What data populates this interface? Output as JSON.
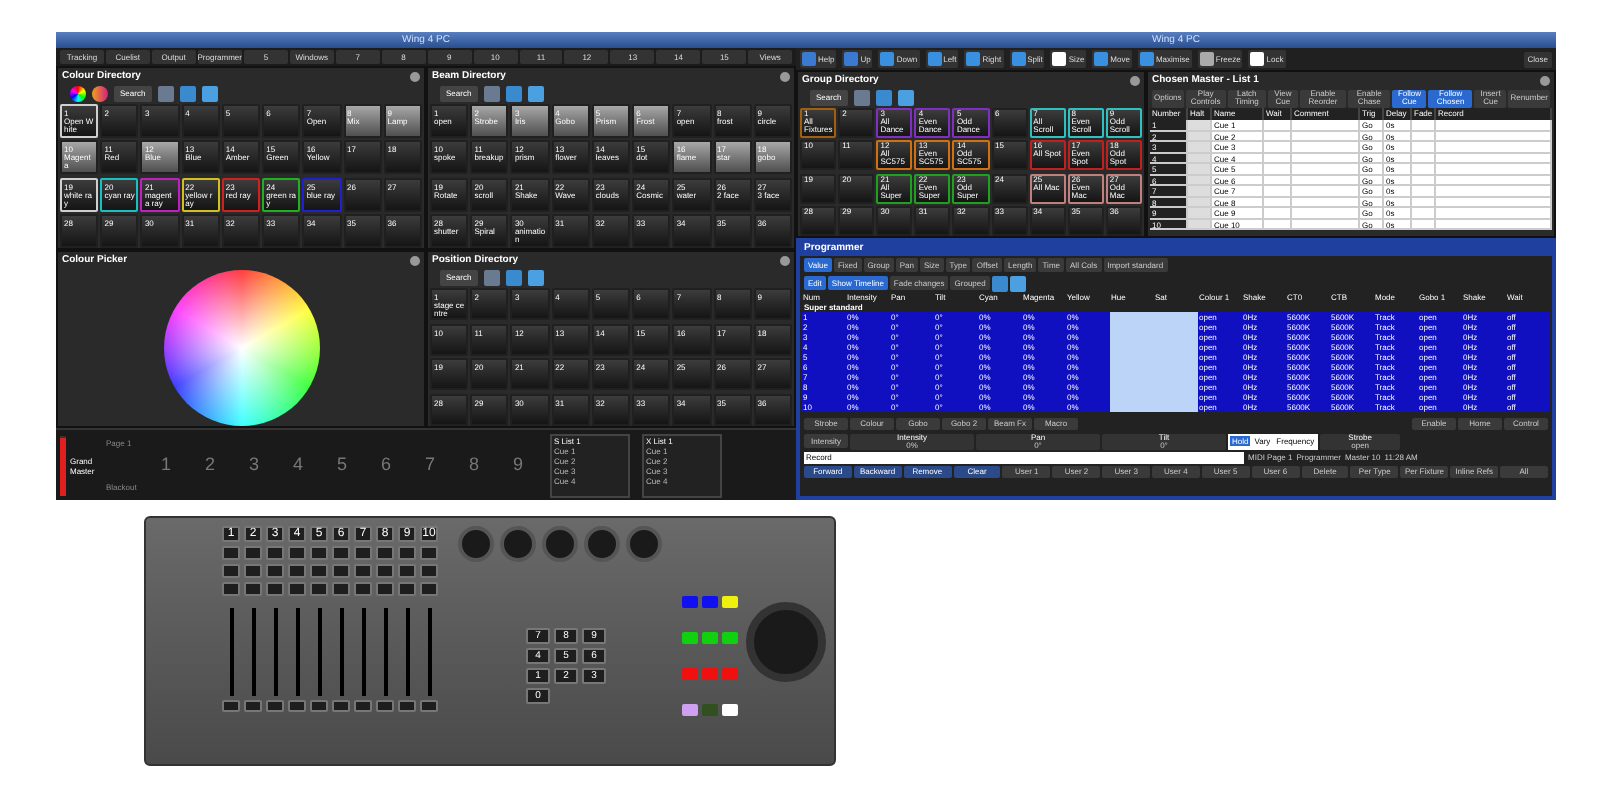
{
  "left_window": {
    "title": "Wing 4 PC",
    "tabs": [
      "Tracking",
      "Cuelist",
      "Output",
      "Programmer",
      "5",
      "Windows",
      "7",
      "8",
      "9",
      "10",
      "11",
      "12",
      "13",
      "14",
      "15",
      "Views"
    ],
    "colour_directory": {
      "title": "Colour Directory",
      "search": "Search",
      "cells": [
        {
          "number": "1",
          "label": "Open White",
          "kind": "outlined"
        },
        {
          "number": "2",
          "kind": "plain"
        },
        {
          "number": "3",
          "kind": "plain"
        },
        {
          "number": "4",
          "kind": "plain"
        },
        {
          "number": "5",
          "kind": "plain"
        },
        {
          "number": "6",
          "kind": "plain"
        },
        {
          "number": "7",
          "label": "Open",
          "kind": "plain"
        },
        {
          "number": "8",
          "label": "Mix",
          "kind": "light"
        },
        {
          "number": "9",
          "label": "Lamp",
          "kind": "light"
        },
        {
          "number": "10",
          "label": "Magenta",
          "kind": "light"
        },
        {
          "number": "11",
          "label": "Red",
          "kind": "plain"
        },
        {
          "number": "12",
          "label": "Blue",
          "kind": "light"
        },
        {
          "number": "13",
          "label": "Blue",
          "kind": "plain"
        },
        {
          "number": "14",
          "label": "Amber",
          "kind": "plain"
        },
        {
          "number": "15",
          "label": "Green",
          "kind": "plain"
        },
        {
          "number": "16",
          "label": "Yellow",
          "kind": "plain"
        },
        {
          "number": "17",
          "kind": "plain"
        },
        {
          "number": "18",
          "kind": "plain"
        },
        {
          "number": "19",
          "label": "white ray",
          "kind": "outlined"
        },
        {
          "number": "20",
          "label": "cyan ray",
          "kind": "plain",
          "color": "#19c0c0"
        },
        {
          "number": "21",
          "label": "magenta ray",
          "kind": "plain",
          "color": "#c020c0"
        },
        {
          "number": "22",
          "label": "yellow ray",
          "kind": "plain",
          "color": "#d0c020"
        },
        {
          "number": "23",
          "label": "red ray",
          "kind": "plain",
          "color": "#d02020"
        },
        {
          "number": "24",
          "label": "green ray",
          "kind": "plain",
          "color": "#20b020"
        },
        {
          "number": "25",
          "label": "blue ray",
          "kind": "plain",
          "color": "#2020d0"
        },
        {
          "number": "26",
          "kind": "plain"
        },
        {
          "number": "27",
          "kind": "plain"
        },
        {
          "number": "28",
          "kind": "plain"
        },
        {
          "number": "29",
          "kind": "plain"
        },
        {
          "number": "30",
          "kind": "plain"
        },
        {
          "number": "31",
          "kind": "plain"
        },
        {
          "number": "32",
          "kind": "plain"
        },
        {
          "number": "33",
          "kind": "plain"
        },
        {
          "number": "34",
          "kind": "plain"
        },
        {
          "number": "35",
          "kind": "plain"
        },
        {
          "number": "36",
          "kind": "plain"
        }
      ]
    },
    "beam_directory": {
      "title": "Beam Directory",
      "search": "Search",
      "cells": [
        {
          "number": "1",
          "label": "open",
          "kind": "plain"
        },
        {
          "number": "2",
          "label": "Strobe",
          "kind": "light"
        },
        {
          "number": "3",
          "label": "Iris",
          "kind": "light"
        },
        {
          "number": "4",
          "label": "Gobo",
          "kind": "light"
        },
        {
          "number": "5",
          "label": "Prism",
          "kind": "light"
        },
        {
          "number": "6",
          "label": "Frost",
          "kind": "light"
        },
        {
          "number": "7",
          "label": "open",
          "kind": "plain"
        },
        {
          "number": "8",
          "label": "frost",
          "kind": "plain"
        },
        {
          "number": "9",
          "label": "circle",
          "kind": "plain"
        },
        {
          "number": "10",
          "label": "spoke",
          "kind": "plain"
        },
        {
          "number": "11",
          "label": "breakup",
          "kind": "plain"
        },
        {
          "number": "12",
          "label": "prism",
          "kind": "plain"
        },
        {
          "number": "13",
          "label": "flower",
          "kind": "plain"
        },
        {
          "number": "14",
          "label": "leaves",
          "kind": "plain"
        },
        {
          "number": "15",
          "label": "dot",
          "kind": "plain"
        },
        {
          "number": "16",
          "label": "flame",
          "kind": "light"
        },
        {
          "number": "17",
          "label": "star",
          "kind": "light"
        },
        {
          "number": "18",
          "label": "gobo",
          "kind": "light"
        },
        {
          "number": "19",
          "label": "Rotate",
          "kind": "plain"
        },
        {
          "number": "20",
          "label": "scroll",
          "kind": "plain"
        },
        {
          "number": "21",
          "label": "Shake",
          "kind": "plain"
        },
        {
          "number": "22",
          "label": "Wave",
          "kind": "plain"
        },
        {
          "number": "23",
          "label": "clouds",
          "kind": "plain"
        },
        {
          "number": "24",
          "label": "Cosmic",
          "kind": "plain"
        },
        {
          "number": "25",
          "label": "water",
          "kind": "plain"
        },
        {
          "number": "26",
          "label": "2 face",
          "kind": "plain"
        },
        {
          "number": "27",
          "label": "3 face",
          "kind": "plain"
        },
        {
          "number": "28",
          "label": "shutter",
          "kind": "plain"
        },
        {
          "number": "29",
          "label": "Spiral",
          "kind": "plain"
        },
        {
          "number": "30",
          "label": "animation",
          "kind": "plain"
        },
        {
          "number": "31",
          "kind": "plain"
        },
        {
          "number": "32",
          "kind": "plain"
        },
        {
          "number": "33",
          "kind": "plain"
        },
        {
          "number": "34",
          "kind": "plain"
        },
        {
          "number": "35",
          "kind": "plain"
        },
        {
          "number": "36",
          "kind": "plain"
        }
      ]
    },
    "colour_picker": {
      "title": "Colour Picker"
    },
    "position_directory": {
      "title": "Position Directory",
      "search": "Search",
      "cells": [
        {
          "number": "1",
          "label": "stage centre"
        },
        {
          "number": "2"
        },
        {
          "number": "3"
        },
        {
          "number": "4"
        },
        {
          "number": "5"
        },
        {
          "number": "6"
        },
        {
          "number": "7"
        },
        {
          "number": "8"
        },
        {
          "number": "9"
        },
        {
          "number": "10"
        },
        {
          "number": "11"
        },
        {
          "number": "12"
        },
        {
          "number": "13"
        },
        {
          "number": "14"
        },
        {
          "number": "15"
        },
        {
          "number": "16"
        },
        {
          "number": "17"
        },
        {
          "number": "18"
        },
        {
          "number": "19"
        },
        {
          "number": "20"
        },
        {
          "number": "21"
        },
        {
          "number": "22"
        },
        {
          "number": "23"
        },
        {
          "number": "24"
        },
        {
          "number": "25"
        },
        {
          "number": "26"
        },
        {
          "number": "27"
        },
        {
          "number": "28"
        },
        {
          "number": "29"
        },
        {
          "number": "30"
        },
        {
          "number": "31"
        },
        {
          "number": "32"
        },
        {
          "number": "33"
        },
        {
          "number": "34"
        },
        {
          "number": "35"
        },
        {
          "number": "36"
        }
      ]
    },
    "playback_bar": {
      "grand_master": "Grand Master",
      "level": 0.95,
      "page": "Page 1",
      "status": "Blackout",
      "playbacks": [
        "1",
        "2",
        "3",
        "4",
        "5",
        "6",
        "7",
        "8",
        "9"
      ],
      "lists": [
        {
          "title": "S List 1",
          "cues": [
            "Cue 1",
            "Cue 2",
            "Cue 3",
            "Cue 4"
          ]
        },
        {
          "title": "X List 1",
          "cues": [
            "Cue 1",
            "Cue 2",
            "Cue 3",
            "Cue 4"
          ]
        }
      ]
    }
  },
  "right_window": {
    "title": "Wing 4 PC",
    "toolbar": [
      "Help",
      "Up",
      "Down",
      "Left",
      "Right",
      "Split",
      "Size",
      "Move",
      "Maximise",
      "Freeze",
      "Lock"
    ],
    "close": "Close",
    "group_directory": {
      "title": "Group Directory",
      "search": "Search",
      "cells": [
        {
          "number": "1",
          "label": "All Fixtures",
          "color": "#a06010"
        },
        {
          "number": "2"
        },
        {
          "number": "3",
          "label": "All Dance",
          "color": "#8030c0"
        },
        {
          "number": "4",
          "label": "Even Dance",
          "color": "#8030c0"
        },
        {
          "number": "5",
          "label": "Odd Dance",
          "color": "#8030c0"
        },
        {
          "number": "6"
        },
        {
          "number": "7",
          "label": "All Scroll",
          "color": "#30c0c0"
        },
        {
          "number": "8",
          "label": "Even Scroll",
          "color": "#30c0c0"
        },
        {
          "number": "9",
          "label": "Odd Scroll",
          "color": "#30c0c0"
        },
        {
          "number": "10"
        },
        {
          "number": "11"
        },
        {
          "number": "12",
          "label": "All SC575",
          "color": "#d07010"
        },
        {
          "number": "13",
          "label": "Even SC575",
          "color": "#d07010"
        },
        {
          "number": "14",
          "label": "Odd SC575",
          "color": "#d07010"
        },
        {
          "number": "15"
        },
        {
          "number": "16",
          "label": "All Spot",
          "color": "#c02020"
        },
        {
          "number": "17",
          "label": "Even Spot",
          "color": "#c02020"
        },
        {
          "number": "18",
          "label": "Odd Spot",
          "color": "#c02020"
        },
        {
          "number": "19"
        },
        {
          "number": "20"
        },
        {
          "number": "21",
          "label": "All Super",
          "color": "#20a020"
        },
        {
          "number": "22",
          "label": "Even Super",
          "color": "#20a020"
        },
        {
          "number": "23",
          "label": "Odd Super",
          "color": "#20a020"
        },
        {
          "number": "24"
        },
        {
          "number": "25",
          "label": "All Mac",
          "color": "#c08080"
        },
        {
          "number": "26",
          "label": "Even Mac",
          "color": "#c08080"
        },
        {
          "number": "27",
          "label": "Odd Mac",
          "color": "#c08080"
        },
        {
          "number": "28"
        },
        {
          "number": "29"
        },
        {
          "number": "30"
        },
        {
          "number": "31"
        },
        {
          "number": "32"
        },
        {
          "number": "33"
        },
        {
          "number": "34"
        },
        {
          "number": "35"
        },
        {
          "number": "36"
        }
      ]
    },
    "chosen_master": {
      "title": "Chosen Master - List 1",
      "buttons": [
        {
          "label": "Options",
          "selected": false
        },
        {
          "label": "Play Controls",
          "selected": false
        },
        {
          "label": "Latch Timing",
          "selected": false
        },
        {
          "label": "View Cue",
          "selected": false
        },
        {
          "label": "Enable Reorder",
          "selected": false
        },
        {
          "label": "Enable Chase",
          "selected": false
        },
        {
          "label": "Follow Cue",
          "selected": true
        },
        {
          "label": "Follow Chosen",
          "selected": true
        },
        {
          "label": "Insert Cue",
          "selected": false
        },
        {
          "label": "Renumber",
          "selected": false
        }
      ],
      "columns": [
        "Number",
        "Halt",
        "Name",
        "Wait",
        "Comment",
        "Trig",
        "Delay",
        "Fade",
        "Record"
      ],
      "rows": [
        [
          "1",
          "",
          "Cue 1",
          "",
          "",
          "Go",
          "0s",
          "",
          ""
        ],
        [
          "2",
          "",
          "Cue 2",
          "",
          "",
          "Go",
          "0s",
          "",
          ""
        ],
        [
          "3",
          "",
          "Cue 3",
          "",
          "",
          "Go",
          "0s",
          "",
          ""
        ],
        [
          "4",
          "",
          "Cue 4",
          "",
          "",
          "Go",
          "0s",
          "",
          ""
        ],
        [
          "5",
          "",
          "Cue 5",
          "",
          "",
          "Go",
          "0s",
          "",
          ""
        ],
        [
          "6",
          "",
          "Cue 6",
          "",
          "",
          "Go",
          "0s",
          "",
          ""
        ],
        [
          "7",
          "",
          "Cue 7",
          "",
          "",
          "Go",
          "0s",
          "",
          ""
        ],
        [
          "8",
          "",
          "Cue 8",
          "",
          "",
          "Go",
          "0s",
          "",
          ""
        ],
        [
          "9",
          "",
          "Cue 9",
          "",
          "",
          "Go",
          "0s",
          "",
          ""
        ],
        [
          "10",
          "",
          "Cue 10",
          "",
          "",
          "Go",
          "0s",
          "",
          ""
        ]
      ]
    },
    "programmer": {
      "title": "Programmer",
      "tabs": [
        {
          "label": "Value",
          "selected": true
        },
        {
          "label": "Fixed",
          "selected": false
        },
        {
          "label": "Group",
          "selected": false
        },
        {
          "label": "Pan",
          "selected": false
        },
        {
          "label": "Size",
          "selected": false
        },
        {
          "label": "Type",
          "selected": false
        },
        {
          "label": "Offset",
          "selected": false
        },
        {
          "label": "Length",
          "selected": false
        },
        {
          "label": "Time",
          "selected": false
        },
        {
          "label": "All Cols",
          "selected": false
        },
        {
          "label": "Import standard",
          "selected": false
        }
      ],
      "options": [
        {
          "label": "Edit",
          "selected": true
        },
        {
          "label": "Show Timeline",
          "selected": true
        },
        {
          "label": "Fade changes",
          "selected": false
        },
        {
          "label": "Grouped",
          "selected": false
        }
      ],
      "columns": [
        "Num",
        "Intensity",
        "Pan",
        "Tilt",
        "Cyan",
        "Magenta",
        "Yellow",
        "Hue",
        "Sat",
        "Colour 1",
        "Shake",
        "CT0",
        "CTB",
        "Mode",
        "Gobo 1",
        "Shake",
        "Wait"
      ],
      "group_label": "Super standard",
      "rows": [
        [
          "1",
          "0%",
          "0°",
          "0°",
          "0%",
          "0%",
          "0%",
          "",
          "",
          "open",
          "0Hz",
          "5600K",
          "5600K",
          "Track",
          "open",
          "0Hz",
          "off"
        ],
        [
          "2",
          "0%",
          "0°",
          "0°",
          "0%",
          "0%",
          "0%",
          "",
          "",
          "open",
          "0Hz",
          "5600K",
          "5600K",
          "Track",
          "open",
          "0Hz",
          "off"
        ],
        [
          "3",
          "0%",
          "0°",
          "0°",
          "0%",
          "0%",
          "0%",
          "",
          "",
          "open",
          "0Hz",
          "5600K",
          "5600K",
          "Track",
          "open",
          "0Hz",
          "off"
        ],
        [
          "4",
          "0%",
          "0°",
          "0°",
          "0%",
          "0%",
          "0%",
          "",
          "",
          "open",
          "0Hz",
          "5600K",
          "5600K",
          "Track",
          "open",
          "0Hz",
          "off"
        ],
        [
          "5",
          "0%",
          "0°",
          "0°",
          "0%",
          "0%",
          "0%",
          "",
          "",
          "open",
          "0Hz",
          "5600K",
          "5600K",
          "Track",
          "open",
          "0Hz",
          "off"
        ],
        [
          "6",
          "0%",
          "0°",
          "0°",
          "0%",
          "0%",
          "0%",
          "",
          "",
          "open",
          "0Hz",
          "5600K",
          "5600K",
          "Track",
          "open",
          "0Hz",
          "off"
        ],
        [
          "7",
          "0%",
          "0°",
          "0°",
          "0%",
          "0%",
          "0%",
          "",
          "",
          "open",
          "0Hz",
          "5600K",
          "5600K",
          "Track",
          "open",
          "0Hz",
          "off"
        ],
        [
          "8",
          "0%",
          "0°",
          "0°",
          "0%",
          "0%",
          "0%",
          "",
          "",
          "open",
          "0Hz",
          "5600K",
          "5600K",
          "Track",
          "open",
          "0Hz",
          "off"
        ],
        [
          "9",
          "0%",
          "0°",
          "0°",
          "0%",
          "0%",
          "0%",
          "",
          "",
          "open",
          "0Hz",
          "5600K",
          "5600K",
          "Track",
          "open",
          "0Hz",
          "off"
        ],
        [
          "10",
          "0%",
          "0°",
          "0°",
          "0%",
          "0%",
          "0%",
          "",
          "",
          "open",
          "0Hz",
          "5600K",
          "5600K",
          "Track",
          "open",
          "0Hz",
          "off"
        ]
      ],
      "feature_buttons": [
        "Strobe",
        "Colour",
        "Gobo",
        "Gobo 2",
        "Beam Fx",
        "Macro"
      ],
      "control_buttons": [
        "Enable",
        "Home",
        "Control"
      ],
      "encoder_button": "Intensity",
      "encoders": [
        {
          "label": "Intensity",
          "value": "0%"
        },
        {
          "label": "Pan",
          "value": "0°"
        },
        {
          "label": "Tilt",
          "value": "0°"
        }
      ],
      "modes": [
        {
          "label": "Hold",
          "selected": true
        },
        {
          "label": "Vary",
          "selected": false
        },
        {
          "label": "Frequency",
          "selected": false
        }
      ],
      "strobe": {
        "label": "Strobe",
        "value": "open"
      },
      "command_line": "Record",
      "status": [
        "MIDI Page 1",
        "Programmer",
        "Master 10",
        "11:28 AM"
      ],
      "bottom_buttons": [
        "Forward",
        "Backward",
        "Remove",
        "Clear",
        "User 1",
        "User 2",
        "User 3",
        "User 4",
        "User 5",
        "User 6",
        "Delete",
        "Per Type",
        "Per Fixture",
        "Inline Refs",
        "All"
      ]
    }
  },
  "console": {
    "number_keys": [
      "1",
      "2",
      "3",
      "4",
      "5",
      "6",
      "7",
      "8",
      "9",
      "10"
    ],
    "keypad": [
      "7",
      "8",
      "9",
      "4",
      "5",
      "6",
      "1",
      "2",
      "3",
      "0"
    ],
    "colour_keys": [
      {
        "color": "#1010f0"
      },
      {
        "color": "#1010f0"
      },
      {
        "color": "#f0f010"
      },
      {
        "color": "#10d010"
      },
      {
        "color": "#10d010"
      },
      {
        "color": "#10d010"
      },
      {
        "color": "#f01010"
      },
      {
        "color": "#f01010"
      },
      {
        "color": "#f01010"
      },
      {
        "color": "#d0a0f0"
      },
      {
        "color": "#305020"
      },
      {
        "color": "#ffffff"
      }
    ]
  }
}
